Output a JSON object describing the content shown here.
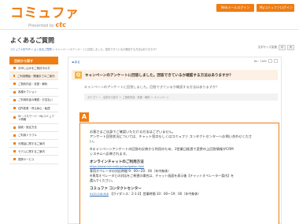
{
  "header": {
    "logo": "コミュファ",
    "logo_sub": "Presented by",
    "logo_brand": "ctc",
    "links": [
      "Webメールログイン",
      "Myコミュファログイン"
    ]
  },
  "page_title": "よくあるご質問",
  "breadcrumb": {
    "home": "コミュファ光TOP",
    "sep1": " > ",
    "faq": "よくあるご質問",
    "sep2": " > ",
    "current": "キャンペーンのアンケートに回答しました。回答できているか確認する方法はありますか？"
  },
  "text_size": {
    "label": "文字サイズ変更",
    "small": "小",
    "large": "大"
  },
  "sidebar": {
    "heading": "目的から探す",
    "items": [
      "お申し込みをご検討中の方",
      "ご利用開始・開通までのご案内",
      "ご契約内容・変更・解約",
      "各種オプション",
      "ご利用料金の確認・お支払い",
      "住所変更・停止休止・転居",
      "ID・パスワード・Myコミュファ情報",
      "接続・設定方法",
      "ご利用トラブル",
      "光電話に関するご案内",
      "モデムに関するご案内",
      "提携サービス"
    ]
  },
  "main": {
    "back": "戻る",
    "count_label": "No：1005",
    "question": "キャンペーンのアンケートに回答しました。回答できているか確認する方法はありますか？",
    "question_sub": "キャンペーンのアンケートに回答しました。回答できているか確認する方法はありますか？",
    "category": "カテゴリー： 目的から探す ＞ ご契約内容・変更・解約 ＞ キャンペーン",
    "answer": {
      "p1": "お客さまご自身でご確認いただける方法はございません。",
      "p2": "アンケート回答状況については、チャット窓口もしくはコミュファ コンタクトセンターへお問い合わせくださ",
      "p3": "い。",
      "p4": "※キャンペーンアンケートの回答の反映から利用のため、3営業日経過で変更の上回答情報がCRM",
      "p5": "システムへ反映されます。",
      "chat_title": "オンラインチャットのご利用方法",
      "chat_link": "https://www.commufa.jp/navigation.html",
      "chat_hours": "専用オペレータの対応時間 9：00〜20：00（年中無休）",
      "chat_note1": "※専用オペレータとの対応をご希望の場合は、チャット画面を表示後【チャットオペレーター案内】を",
      "chat_note2": "選んでください。",
      "center_title": "コミュファ コンタクトセンター",
      "center_tel": "0120-218-818",
      "center_hours": "【ガイダンス：2-1-2】営業時間 10：00〜19：00（年中無休）"
    }
  },
  "colors": {
    "accent": "#ee7d14",
    "q_badge": "#f3b63e",
    "q_bg": "#fdf0e4",
    "link": "#3366aa"
  }
}
